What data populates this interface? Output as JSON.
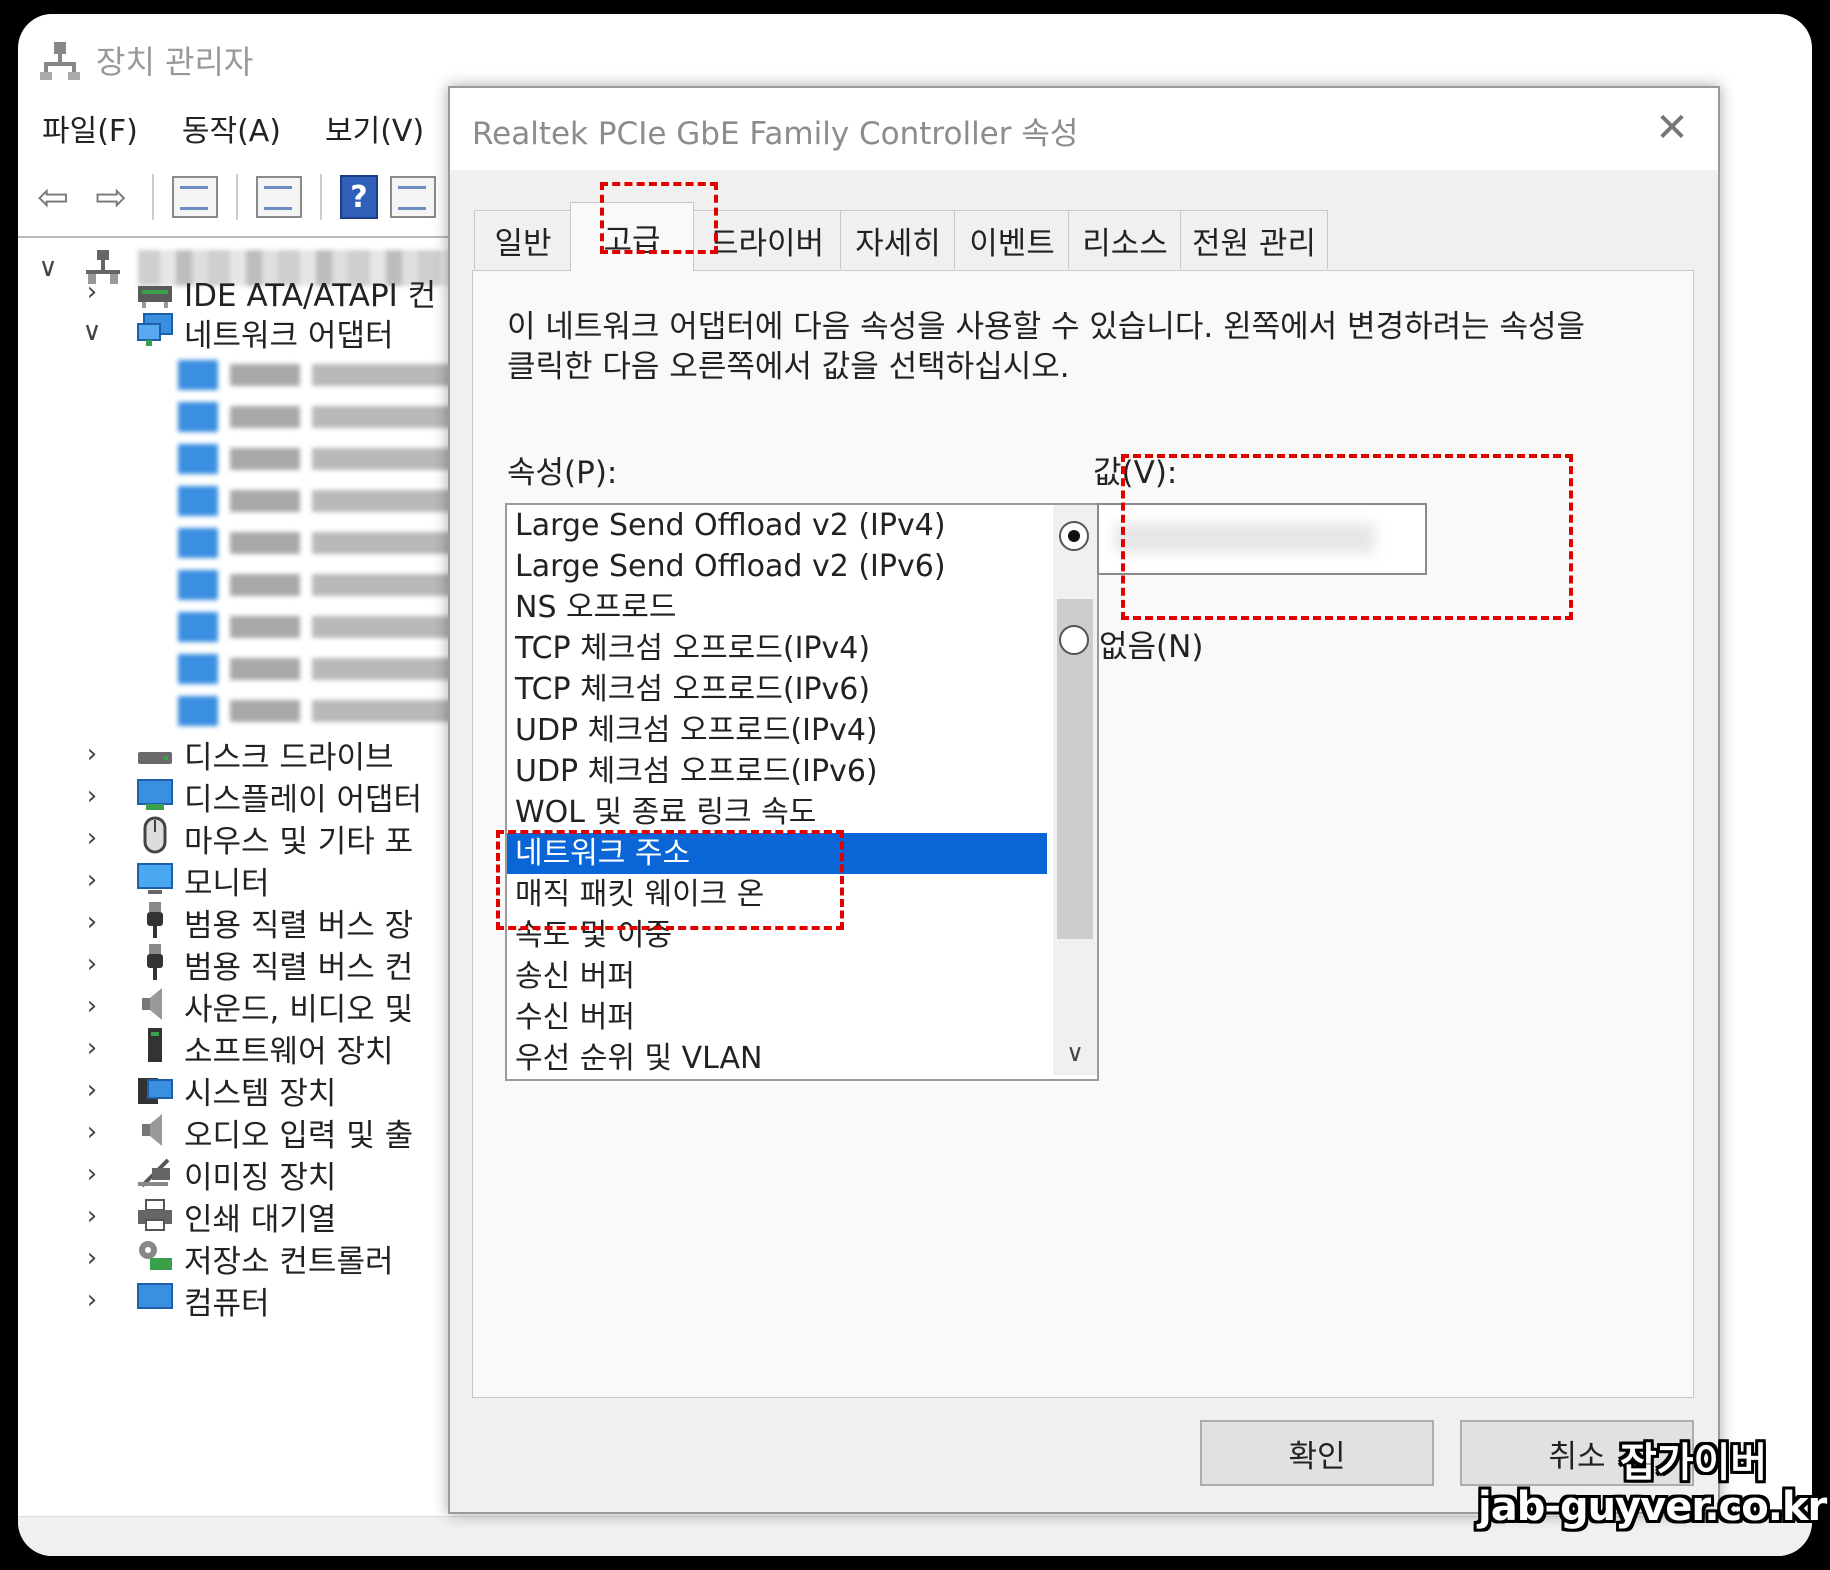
{
  "device_manager": {
    "title": "장치 관리자",
    "menu": [
      "파일(F)",
      "동작(A)",
      "보기(V)"
    ],
    "tree_items": [
      {
        "label": "IDE ATA/ATAPI 컨",
        "icon": "ide-controller-icon",
        "state": "collapsed"
      },
      {
        "label": "네트워크 어댑터",
        "icon": "network-adapter-icon",
        "state": "expanded"
      },
      {
        "label": "디스크 드라이브",
        "icon": "disk-drive-icon",
        "state": "collapsed"
      },
      {
        "label": "디스플레이 어댑터",
        "icon": "display-adapter-icon",
        "state": "collapsed"
      },
      {
        "label": "마우스 및 기타 포",
        "icon": "mouse-icon",
        "state": "collapsed"
      },
      {
        "label": "모니터",
        "icon": "monitor-icon",
        "state": "collapsed"
      },
      {
        "label": "범용 직렬 버스 장",
        "icon": "usb-icon",
        "state": "collapsed"
      },
      {
        "label": "범용 직렬 버스 컨",
        "icon": "usb-icon",
        "state": "collapsed"
      },
      {
        "label": "사운드, 비디오 및",
        "icon": "speaker-icon",
        "state": "collapsed"
      },
      {
        "label": "소프트웨어 장치",
        "icon": "software-device-icon",
        "state": "collapsed"
      },
      {
        "label": "시스템 장치",
        "icon": "system-device-icon",
        "state": "collapsed"
      },
      {
        "label": "오디오 입력 및 출",
        "icon": "speaker-icon",
        "state": "collapsed"
      },
      {
        "label": "이미징 장치",
        "icon": "camera-icon",
        "state": "collapsed"
      },
      {
        "label": "인쇄 대기열",
        "icon": "printer-icon",
        "state": "collapsed"
      },
      {
        "label": "저장소 컨트롤러",
        "icon": "storage-controller-icon",
        "state": "collapsed"
      },
      {
        "label": "컴퓨터",
        "icon": "computer-icon",
        "state": "collapsed"
      }
    ]
  },
  "dialog": {
    "title": "Realtek PCIe GbE Family Controller 속성",
    "tabs": [
      "일반",
      "고급",
      "드라이버",
      "자세히",
      "이벤트",
      "리소스",
      "전원 관리"
    ],
    "active_tab": "고급",
    "description": "이 네트워크 어댑터에 다음 속성을 사용할 수 있습니다. 왼쪽에서 변경하려는 속성을 클릭한 다음 오른쪽에서 값을 선택하십시오.",
    "property_label": "속성(P):",
    "value_label": "값(V):",
    "properties": [
      "Large Send Offload v2 (IPv4)",
      "Large Send Offload v2 (IPv6)",
      "NS 오프로드",
      "TCP 체크섬 오프로드(IPv4)",
      "TCP 체크섬 오프로드(IPv6)",
      "UDP 체크섬 오프로드(IPv4)",
      "UDP 체크섬 오프로드(IPv6)",
      "WOL 및 종료 링크 속도",
      "네트워크 주소",
      "매직 패킷 웨이크 온",
      "속도 및 이중",
      "송신 버퍼",
      "수신 버퍼",
      "우선 순위 및 VLAN"
    ],
    "selected_property": "네트워크 주소",
    "value_input": "",
    "none_option": "없음(N)",
    "ok_button": "확인",
    "cancel_button": "취소"
  },
  "watermark": {
    "name": "잡가이버",
    "url": "jab-guyver.co.kr"
  },
  "colors": {
    "selection": "#0a66d6",
    "highlight_box": "#e00000"
  }
}
